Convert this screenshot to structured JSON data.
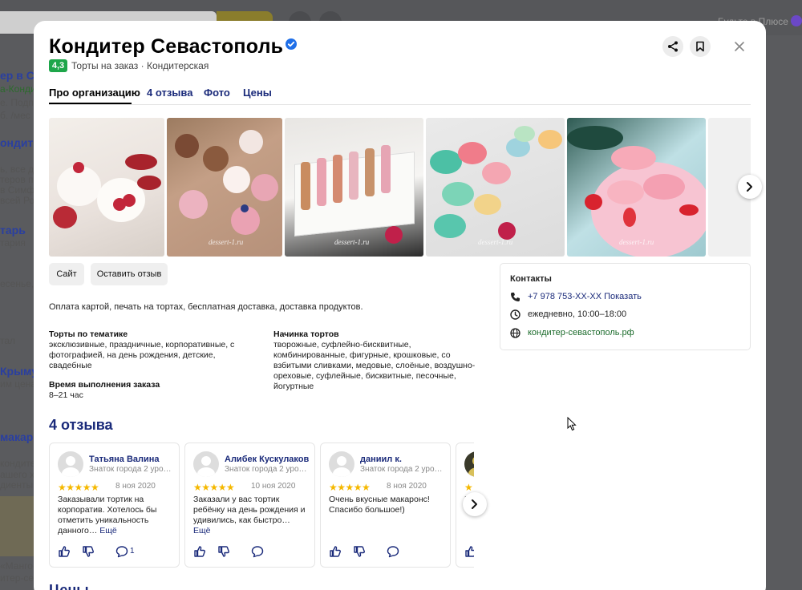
{
  "background": {
    "plus_label": "Будьте в Плюсе",
    "left_snippets": [
      "ер в Се",
      "а-Конди",
      "е. Подп",
      "б. /мес ·",
      "ондите",
      "ь, все дл",
      "теров по",
      "в Симф",
      "всей Ро",
      "тарь",
      "тария",
      "есенье,",
      "тал",
      "Крыму",
      "им ценам",
      "макар",
      "кондите",
      "ашего хор",
      "диенты н",
      "«Манго-",
      "итер-сев"
    ]
  },
  "modal": {
    "title": "Кондитер Севастополь",
    "rating": "4,3",
    "subtitle": "Торты на заказ · Кондитерская",
    "tabs": [
      "Про организацию",
      "4 отзыва",
      "Фото",
      "Цены"
    ],
    "photo_watermark": "dessert-1.ru",
    "buttons": {
      "site": "Сайт",
      "review": "Оставить отзыв"
    },
    "description": "Оплата картой, печать на тортах, бесплатная доставка, доставка продуктов.",
    "features": [
      {
        "title": "Торты по тематике",
        "text": "эксклюзивные, праздничные, корпоративные, с фотографией, на день рождения, детские, свадебные"
      },
      {
        "title": "Начинка тортов",
        "text": "творожные, суфлейно-бисквитные, комбинированные, фигурные, крошковые, со взбитыми сливками, медовые, слоёные, воздушно-ореховые, суфлейные, бисквитные, песочные, йогуртные"
      },
      {
        "title": "Время выполнения заказа",
        "text": "8–21 час"
      }
    ],
    "contacts": {
      "title": "Контакты",
      "phone": "+7 978 753-XX-XX Показать",
      "hours": "ежедневно, 10:00–18:00",
      "website": "кондитер-севастополь.рф"
    },
    "reviews_title": "4 отзыва",
    "reviews": [
      {
        "name": "Татьяна Валина",
        "meta": "Знаток города 2 уро…",
        "stars": "★★★★★",
        "date": "8 ноя 2020",
        "text": "Заказывали тортик на корпоратив. Хотелось бы отметить уникальность данного…",
        "more": "Ещё",
        "comments": "1"
      },
      {
        "name": "Алибек Кускулаков",
        "meta": "Знаток города 2 уро…",
        "stars": "★★★★★",
        "date": "10 ноя 2020",
        "text": "Заказали у вас тортик ребёнку на день рождения и удивились, как быстро…",
        "more": "Ещё",
        "comments": ""
      },
      {
        "name": "даниил к.",
        "meta": "Знаток города 2 уро…",
        "stars": "★★★★★",
        "date": "8 ноя 2020",
        "text": "Очень вкусные макаронс! Спасибо большое!)",
        "more": "",
        "comments": ""
      },
      {
        "name": "",
        "meta": "",
        "stars": "★",
        "date": "",
        "text": "Б",
        "more": "",
        "comments": ""
      }
    ],
    "prices_title": "Цены",
    "icons": {
      "verified": "verified-check-icon",
      "share": "share-icon",
      "bookmark": "bookmark-icon",
      "close": "close-icon",
      "phone": "phone-icon",
      "clock": "clock-icon",
      "globe": "globe-icon",
      "like": "thumbs-up-icon",
      "dislike": "thumbs-down-icon",
      "comment": "comment-icon",
      "chevron": "chevron-right-icon"
    },
    "colors": {
      "accent_link": "#1a2a7a",
      "rating_green": "#1ea64a",
      "star": "#f5b800",
      "website_green": "#1b6b2b"
    }
  }
}
